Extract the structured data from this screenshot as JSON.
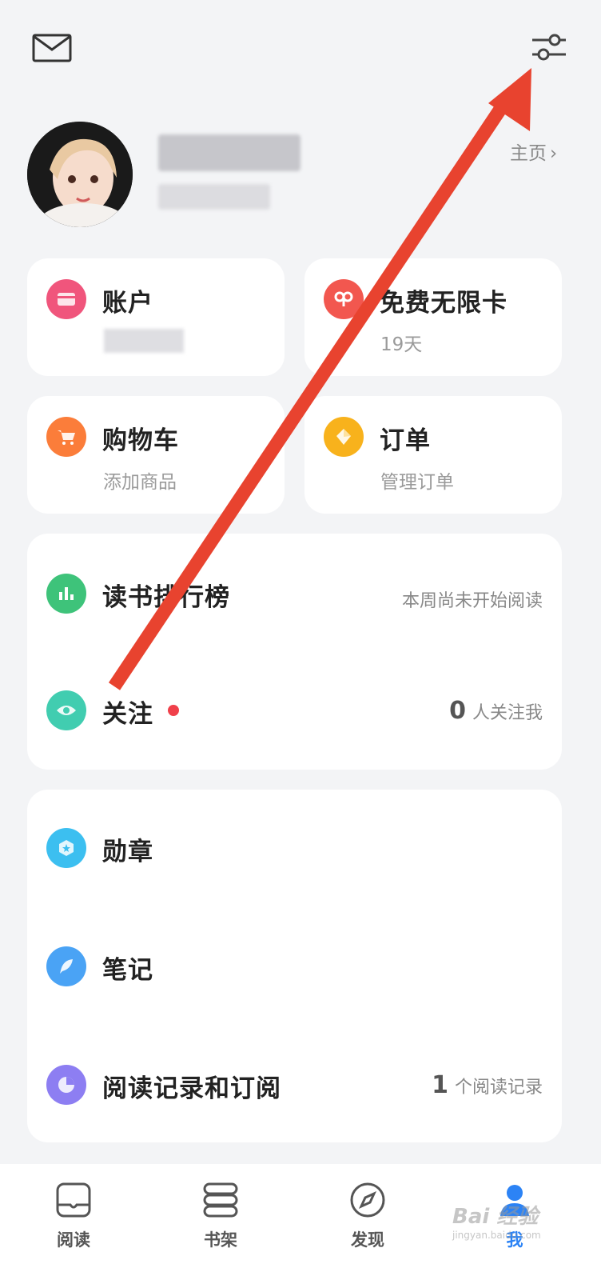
{
  "header": {
    "mail_icon": "mail-icon",
    "settings_icon": "settings-sliders-icon",
    "homepage_link": "主页"
  },
  "cards": {
    "account": {
      "title": "账户",
      "color": "#f0557c"
    },
    "free_card": {
      "title": "免费无限卡",
      "subtitle": "19天",
      "color": "#f2574f"
    },
    "cart": {
      "title": "购物车",
      "subtitle": "添加商品",
      "color": "#fb7d3a"
    },
    "orders": {
      "title": "订单",
      "subtitle": "管理订单",
      "color": "#f8b21c"
    }
  },
  "list1": {
    "ranking": {
      "title": "读书排行榜",
      "right": "本周尚未开始阅读",
      "color": "#3ec37a"
    },
    "follow": {
      "title": "关注",
      "count": "0",
      "right": "人关注我",
      "color": "#41cdb0"
    }
  },
  "list2": {
    "medals": {
      "title": "勋章",
      "color": "#3cbff0"
    },
    "notes": {
      "title": "笔记",
      "color": "#4aa3f5"
    },
    "history": {
      "title": "阅读记录和订阅",
      "count": "1",
      "right": "个阅读记录",
      "color": "#8d7ef2"
    }
  },
  "tabbar": {
    "read": "阅读",
    "shelf": "书架",
    "discover": "发现",
    "me": "我"
  },
  "watermark": "Bai 经验",
  "watermark_sub": "jingyan.baidu.com",
  "accent_color": "#2c83f5",
  "annotation_arrow_color": "#e8432f"
}
